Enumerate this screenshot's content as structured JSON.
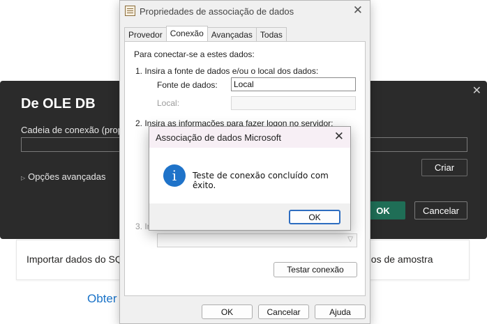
{
  "background": {
    "card_left_text": "Importar dados do SQ",
    "card_right_text": "dos de amostra",
    "link_text": "Obter"
  },
  "ole_dialog": {
    "title": "De OLE DB",
    "connection_label": "Cadeia de conexão (propri",
    "connection_value": "",
    "advanced_label": "Opções avançadas",
    "create_button": "Criar",
    "ok_button": "OK",
    "cancel_button": "Cancelar",
    "close_icon": "close-icon",
    "accent_color": "#1f6e56"
  },
  "properties": {
    "title": "Propriedades de associação de dados",
    "tabs": [
      "Provedor",
      "Conexão",
      "Avançadas",
      "Todas"
    ],
    "active_tab": "Conexão",
    "intro": "Para conectar-se a estes dados:",
    "step1": "1. Insira a fonte de dados e/ou o local dos dados:",
    "datasource_label": "Fonte de dados:",
    "datasource_value": "Local",
    "location_label": "Local:",
    "location_value": "",
    "step2": "2. Insira as informações para fazer logon no servidor:",
    "step3_fragment": "3. In",
    "test_button": "Testar conexão",
    "ok_button": "OK",
    "cancel_button": "Cancelar",
    "help_button": "Ajuda"
  },
  "message_box": {
    "title": "Associação de dados Microsoft",
    "message": "Teste de conexão concluído com êxito.",
    "ok_button": "OK",
    "icon": "info-icon",
    "icon_color": "#1f73c9"
  }
}
